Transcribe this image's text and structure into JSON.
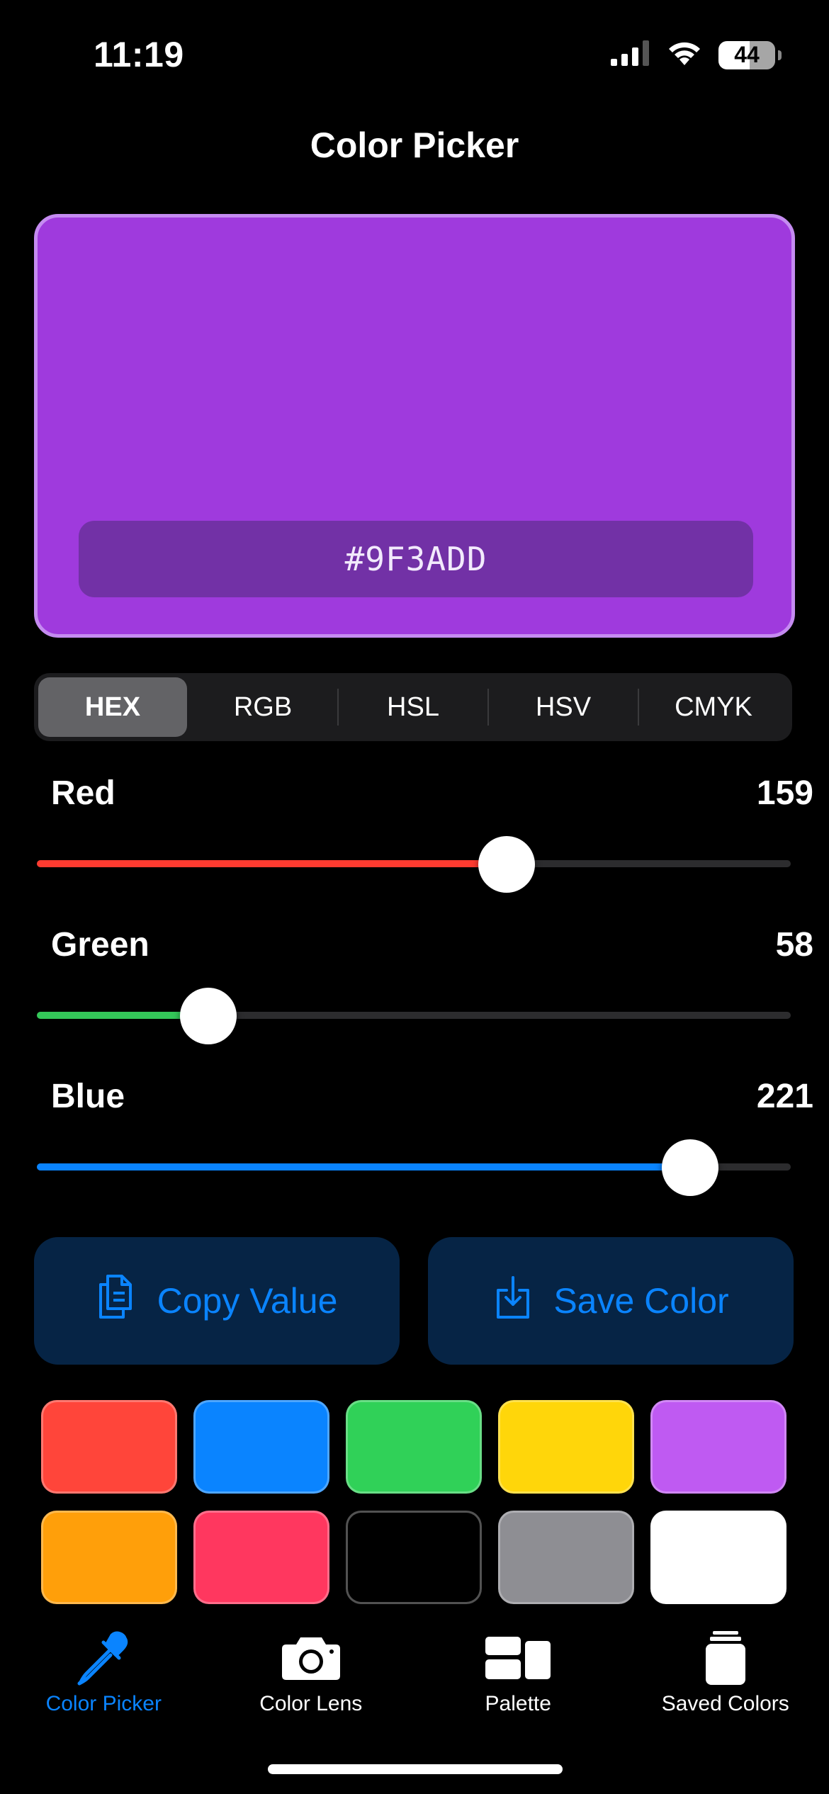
{
  "status_bar": {
    "time": "11:19",
    "battery": "44",
    "icons": [
      "cellular-signal-icon",
      "wifi-icon",
      "battery-icon"
    ]
  },
  "header": {
    "title": "Color Picker"
  },
  "preview": {
    "color": "#9F3ADD",
    "border_color": "#C58BF1",
    "hex_label": "#9F3ADD"
  },
  "format_tabs": [
    {
      "label": "HEX",
      "active": true
    },
    {
      "label": "RGB",
      "active": false
    },
    {
      "label": "HSL",
      "active": false
    },
    {
      "label": "HSV",
      "active": false
    },
    {
      "label": "CMYK",
      "active": false
    }
  ],
  "sliders": [
    {
      "label": "Red",
      "value": "159",
      "fraction": 0.6235,
      "color": "#FF3B30"
    },
    {
      "label": "Green",
      "value": "58",
      "fraction": 0.2275,
      "color": "#34C759"
    },
    {
      "label": "Blue",
      "value": "221",
      "fraction": 0.8667,
      "color": "#0A84FF"
    }
  ],
  "actions": {
    "copy_label": "Copy Value",
    "save_label": "Save Color",
    "icons": [
      "copy-icon",
      "save-icon"
    ]
  },
  "swatches": [
    {
      "name": "red",
      "color": "#FF453A"
    },
    {
      "name": "blue",
      "color": "#0A84FF"
    },
    {
      "name": "green",
      "color": "#30D158"
    },
    {
      "name": "yellow",
      "color": "#FFD60A"
    },
    {
      "name": "purple",
      "color": "#BF5AF2"
    },
    {
      "name": "orange",
      "color": "#FF9F0A"
    },
    {
      "name": "pink",
      "color": "#FF375F"
    },
    {
      "name": "black",
      "color": "#000000"
    },
    {
      "name": "gray",
      "color": "#8E8E93"
    },
    {
      "name": "white",
      "color": "#FFFFFF"
    }
  ],
  "tab_bar": [
    {
      "label": "Color Picker",
      "icon": "eyedropper-icon",
      "active": true
    },
    {
      "label": "Color Lens",
      "icon": "camera-icon",
      "active": false
    },
    {
      "label": "Palette",
      "icon": "palette-icon",
      "active": false
    },
    {
      "label": "Saved Colors",
      "icon": "saved-colors-icon",
      "active": false
    }
  ],
  "accent_color": "#0A84FF"
}
